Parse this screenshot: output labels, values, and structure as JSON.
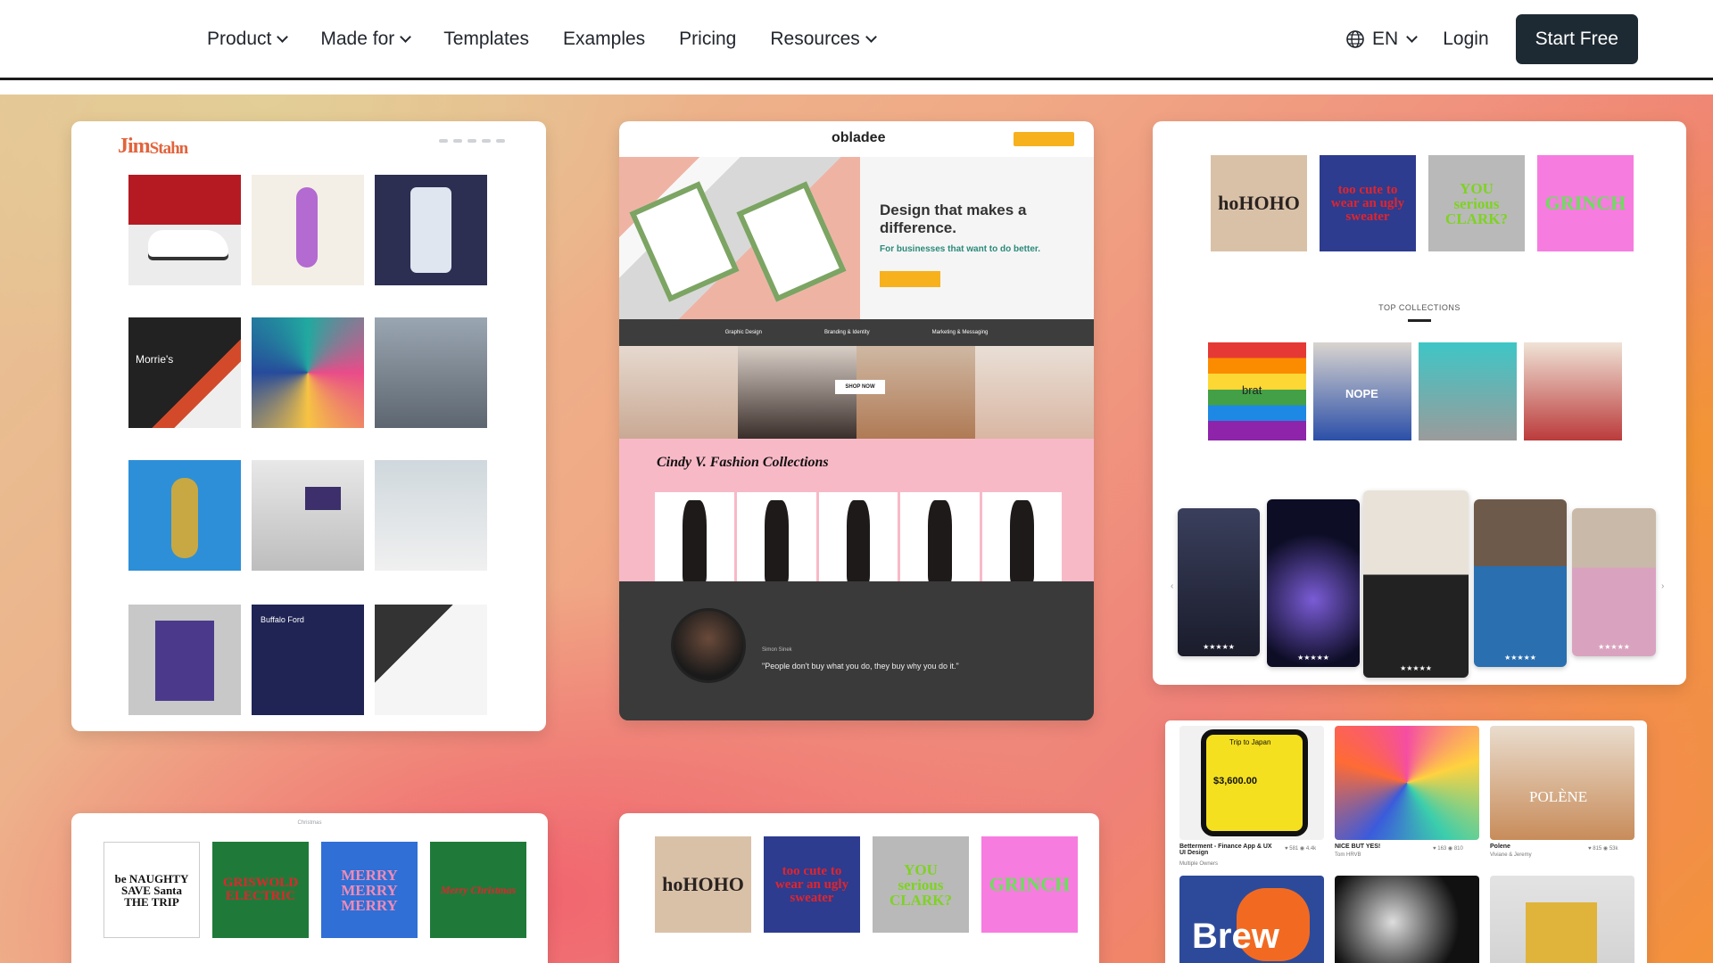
{
  "nav": {
    "items": [
      {
        "label": "Product",
        "dropdown": true
      },
      {
        "label": "Made for",
        "dropdown": true
      },
      {
        "label": "Templates",
        "dropdown": false
      },
      {
        "label": "Examples",
        "dropdown": false
      },
      {
        "label": "Pricing",
        "dropdown": false
      },
      {
        "label": "Resources",
        "dropdown": true
      }
    ],
    "language": "EN",
    "login": "Login",
    "cta": "Start Free"
  },
  "colors": {
    "cta_bg": "#1e2a33",
    "jim_accent": "#e2633c",
    "obladee_yellow": "#f6b11d",
    "fashion_pink": "#f8b9c7"
  },
  "jim": {
    "logo_first": "Jim",
    "logo_last": "Stahn"
  },
  "obladee": {
    "logo": "obladee",
    "headline": "Design that makes a difference.",
    "subhead": "For businesses that want to do better.",
    "services": [
      "Graphic Design",
      "Branding & Identity",
      "Marketing & Messaging"
    ],
    "shop_button": "SHOP NOW",
    "fashion_title": "Cindy V. Fashion Collections",
    "quote_name": "Simon Sinek",
    "quote": "\"People don't buy what you do, they buy why you do it.\""
  },
  "merch": {
    "designs": [
      {
        "text": "hoHOHO",
        "bg": "#d9c1a8",
        "fg": "#2a2320"
      },
      {
        "text": "too cute to wear an ugly sweater",
        "bg": "#2d3c8f",
        "fg": "#e3242b"
      },
      {
        "text": "YOU serious CLARK?",
        "bg": "#b9b9b9",
        "fg": "#7ed321"
      },
      {
        "text": "GRINCH",
        "bg": "#f77ce0",
        "fg": "#69e05a"
      }
    ],
    "top_collections": "TOP COLLECTIONS",
    "collection_labels": [
      "brat",
      "NOPE"
    ]
  },
  "card5": {
    "header": "Christmas",
    "designs": [
      {
        "text": "be NAUGHTY SAVE Santa THE TRIP",
        "bg": "#ffffff",
        "fg": "#111111"
      },
      {
        "text": "GRISWOLD ELECTRIC",
        "bg": "#1f7a3a",
        "fg": "#e3242b"
      },
      {
        "text": "MERRY MERRY MERRY",
        "bg": "#2f6fd6",
        "fg": "#f18bb4"
      },
      {
        "text": "Merry Christmas",
        "bg": "#1f7a3a",
        "fg": "#e3242b"
      }
    ]
  },
  "dribbble": {
    "shots": [
      {
        "title": "Betterment - Finance App & UX UI Design",
        "author": "Multiple Owners",
        "likes": "581",
        "views": "4.4k",
        "overlay": "$3,600.00",
        "overlay_head": "Trip to Japan"
      },
      {
        "title": "NICE BUT YES!",
        "author": "Tom HRVB",
        "likes": "163",
        "views": "810",
        "overlay": ""
      },
      {
        "title": "Polene",
        "author": "Viviane & Jeremy",
        "likes": "815",
        "views": "53k",
        "overlay": "POLÈNE"
      }
    ],
    "brew": "Brew"
  }
}
